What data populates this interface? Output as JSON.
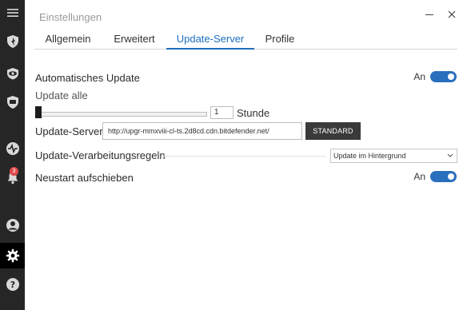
{
  "window": {
    "title": "Einstellungen",
    "minimize_label": "—",
    "close_label": "×"
  },
  "sidebar": {
    "items": [
      {
        "name": "menu-icon"
      },
      {
        "name": "shield-icon"
      },
      {
        "name": "eye-icon"
      },
      {
        "name": "tv-shield-icon"
      },
      {
        "name": "activity-icon"
      },
      {
        "name": "notifications-icon",
        "badge": "3"
      },
      {
        "name": "account-icon"
      },
      {
        "name": "settings-icon",
        "active": true
      },
      {
        "name": "help-icon"
      }
    ]
  },
  "tabs": [
    {
      "label": "Allgemein"
    },
    {
      "label": "Erweitert"
    },
    {
      "label": "Update-Server",
      "active": true
    },
    {
      "label": "Profile"
    }
  ],
  "settings": {
    "auto_update": {
      "label": "Automatisches Update",
      "state_label": "An",
      "on": true
    },
    "update_interval": {
      "label": "Update alle",
      "value": "1",
      "unit": "Stunde",
      "slider_fraction": 0.0
    },
    "update_server": {
      "label": "Update-Server",
      "value": "http://upgr-mmxviii-cl-ts.2d8cd.cdn.bitdefender.net/",
      "button_label": "STANDARD"
    },
    "processing_rules": {
      "label": "Update-Verarbeitungsregeln",
      "selected": "Update im Hintergrund"
    },
    "postpone_restart": {
      "label": "Neustart aufschieben",
      "state_label": "An",
      "on": true
    }
  },
  "colors": {
    "accent": "#2a6fbe",
    "tab_active": "#1e6fbf",
    "sidebar_bg": "#262626",
    "badge": "#e24b4b"
  }
}
